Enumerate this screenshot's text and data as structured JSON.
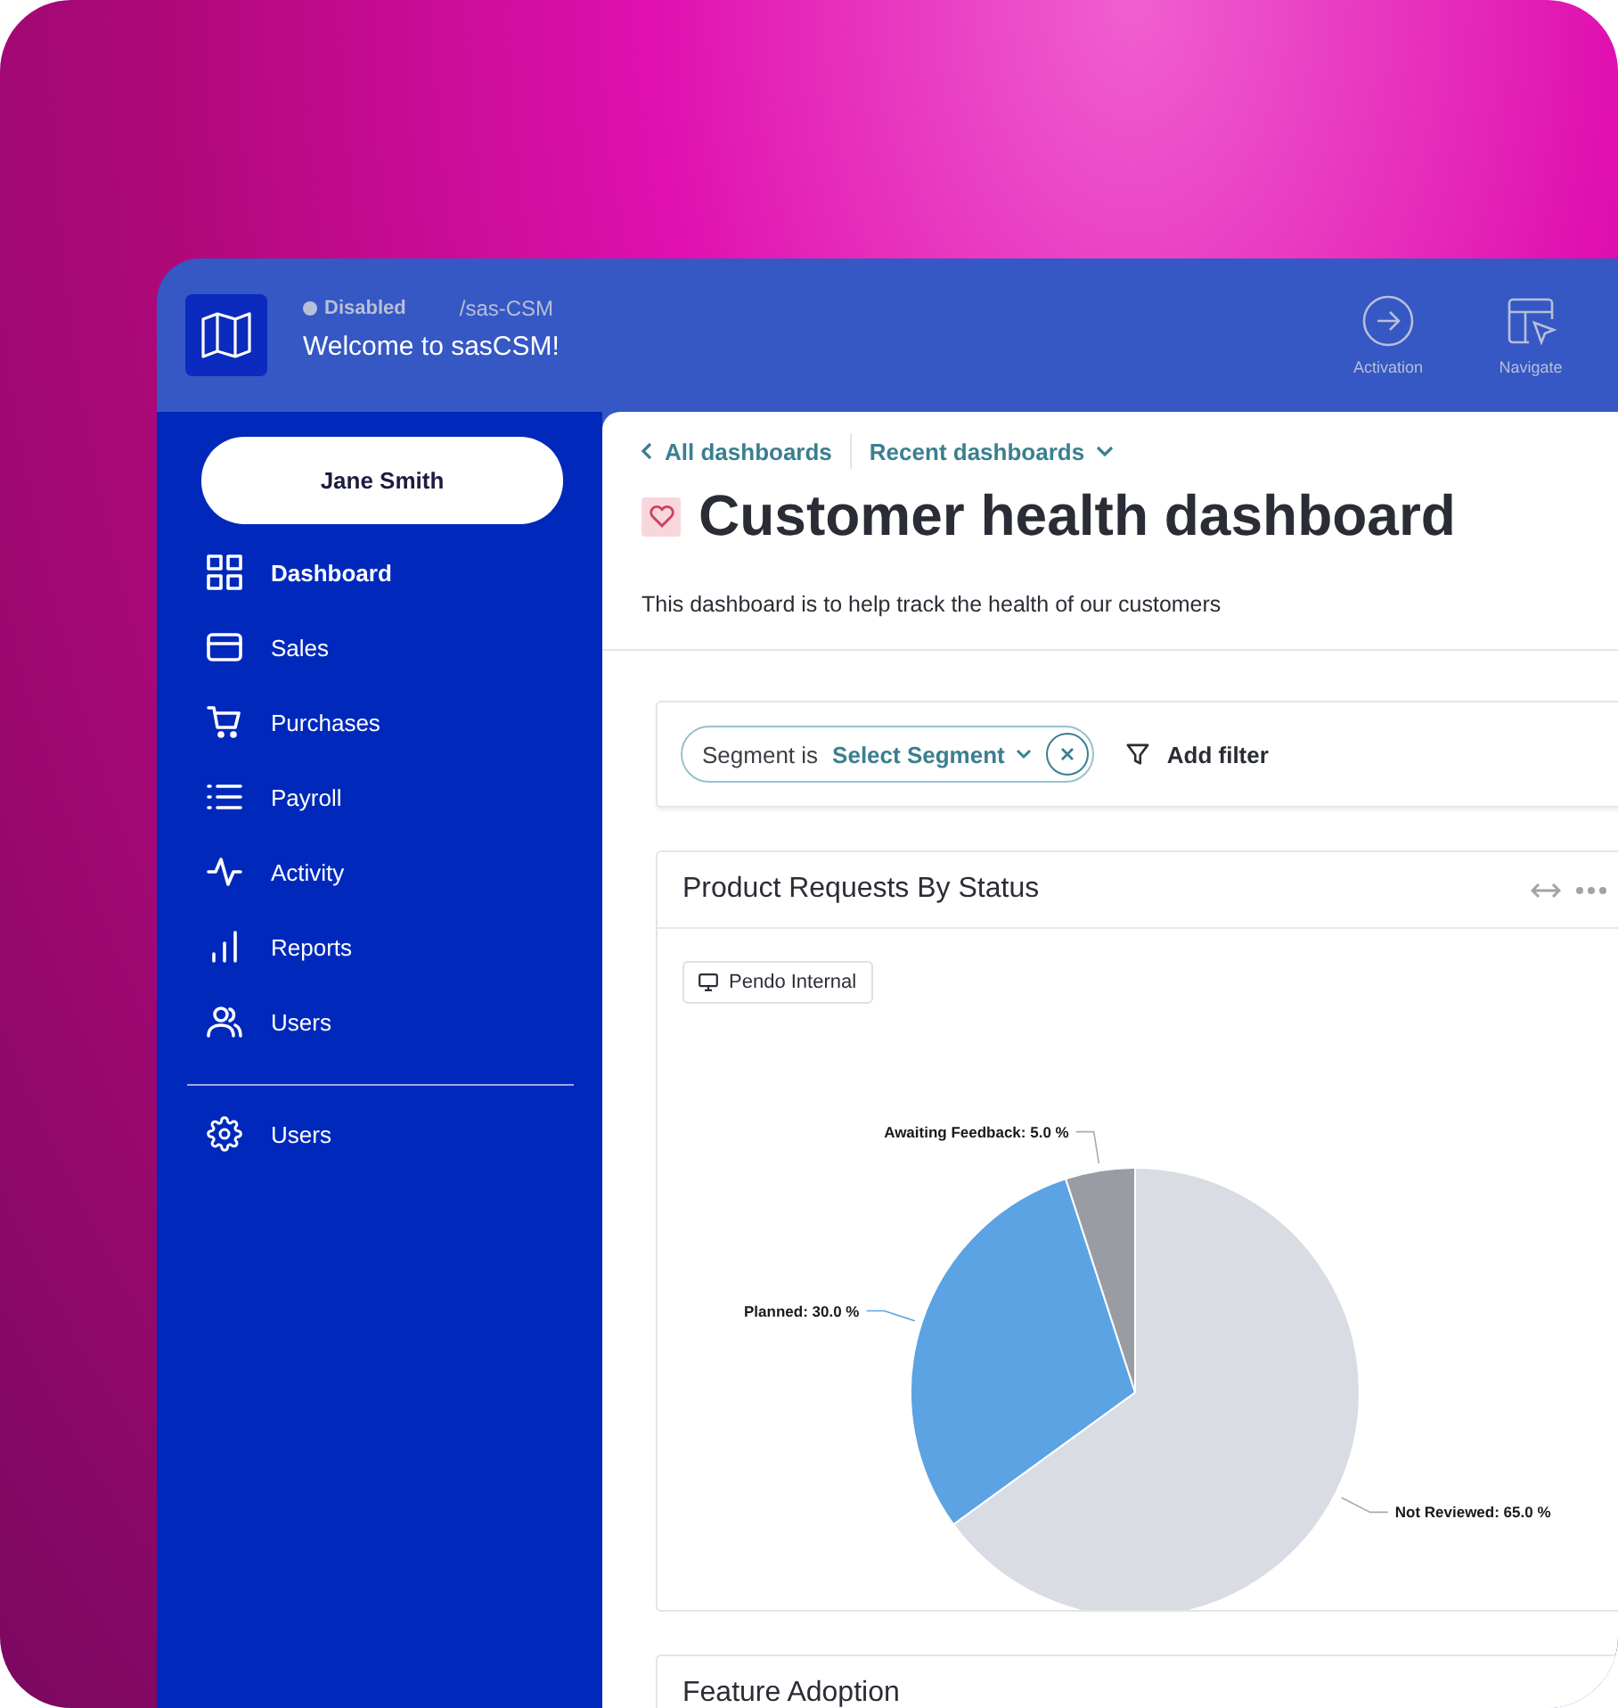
{
  "header": {
    "status": {
      "label": "Disabled",
      "on": false
    },
    "path": "/sas-CSM",
    "title": "Welcome to sasCSM!",
    "actions": [
      {
        "label": "Activation"
      },
      {
        "label": "Navigate"
      }
    ]
  },
  "sidebar": {
    "user": "Jane Smith",
    "items": [
      {
        "label": "Dashboard",
        "selected": true
      },
      {
        "label": "Sales",
        "selected": false
      },
      {
        "label": "Purchases",
        "selected": false
      },
      {
        "label": "Payroll",
        "selected": false
      },
      {
        "label": "Activity",
        "selected": false
      },
      {
        "label": "Reports",
        "selected": false
      },
      {
        "label": "Users",
        "selected": false
      }
    ],
    "footer_items": [
      {
        "label": "Users",
        "selected": false
      }
    ]
  },
  "breadcrumbs": {
    "back": "All dashboards",
    "recent": "Recent dashboards"
  },
  "page": {
    "title": "Customer health dashboard",
    "favorite": true,
    "description": "This dashboard is to help track the health of our customers"
  },
  "filter": {
    "label": "Segment is",
    "value": "Select Segment",
    "add": "Add filter"
  },
  "cards": [
    {
      "title": "Product Requests By Status",
      "tag": "Pendo Internal",
      "chart_data": {
        "type": "pie",
        "categories": [
          "Not Reviewed: 65.0 %",
          "Planned: 30.0 %",
          "Awaiting Feedback: 5.0 %"
        ],
        "values": [
          65.0,
          30.0,
          5.0
        ]
      }
    },
    {
      "title": "Feature Adoption"
    }
  ]
}
